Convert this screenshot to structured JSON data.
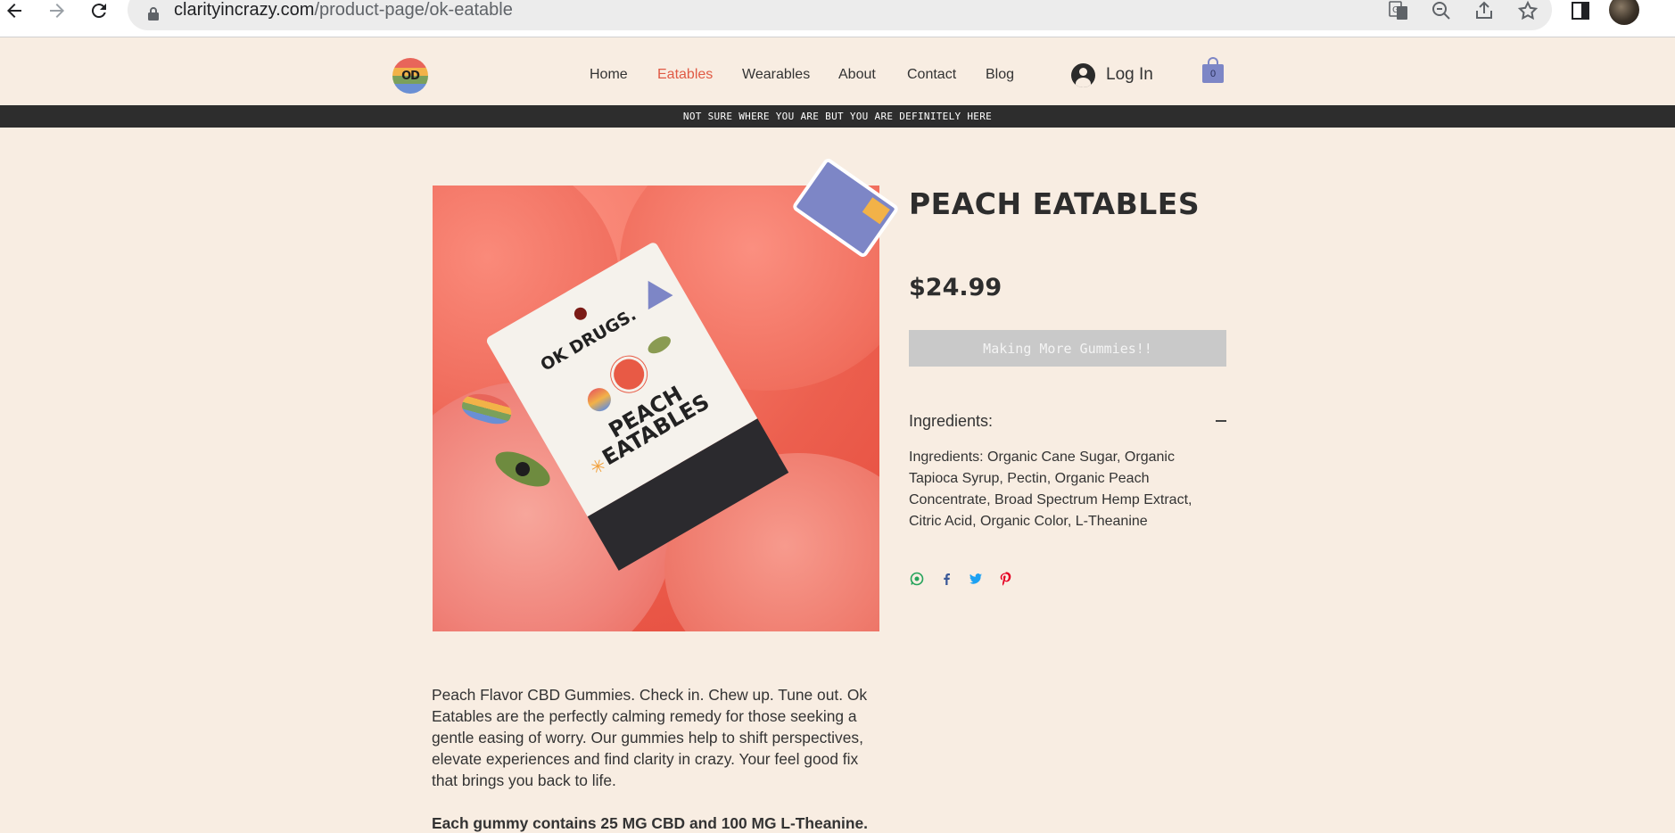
{
  "browser": {
    "url_host": "clarityincrazy.com",
    "url_path": "/product-page/ok-eatable"
  },
  "header": {
    "logo_text": "OD",
    "nav": [
      {
        "label": "Home",
        "active": false
      },
      {
        "label": "Eatables",
        "active": true
      },
      {
        "label": "Wearables",
        "active": false
      },
      {
        "label": "About",
        "active": false
      },
      {
        "label": "Contact",
        "active": false
      },
      {
        "label": "Blog",
        "active": false
      }
    ],
    "login_label": "Log In",
    "cart_count": "0",
    "accent_color": "#e05a45"
  },
  "announcement": "NOT SURE WHERE YOU ARE BUT YOU ARE DEFINITELY HERE",
  "product": {
    "title": "PEACH EATABLES",
    "price": "$24.99",
    "oos_button_label": "Making More Gummies!!",
    "ingredients_label": "Ingredients:",
    "ingredients_text": "Ingredients: Organic Cane Sugar, Organic Tapioca Syrup, Pectin, Organic Peach Concentrate, Broad Spectrum Hemp Extract, Citric Acid, Organic Color, L-Theanine",
    "image": {
      "package_brand": "OK DRUGS.",
      "package_title": "PEACH EATABLES"
    },
    "share_icons": [
      "whatsapp-icon",
      "facebook-icon",
      "twitter-icon",
      "pinterest-icon"
    ],
    "description": "Peach Flavor CBD Gummies. Check in. Chew up. Tune out. Ok Eatables are the perfectly calming remedy for those seeking a gentle easing of worry. Our gummies help to shift perspectives, elevate experiences and find clarity in crazy. Your feel good fix that brings you back to life.",
    "description_bold": "Each gummy contains 25 MG CBD and 100 MG L-Theanine."
  }
}
